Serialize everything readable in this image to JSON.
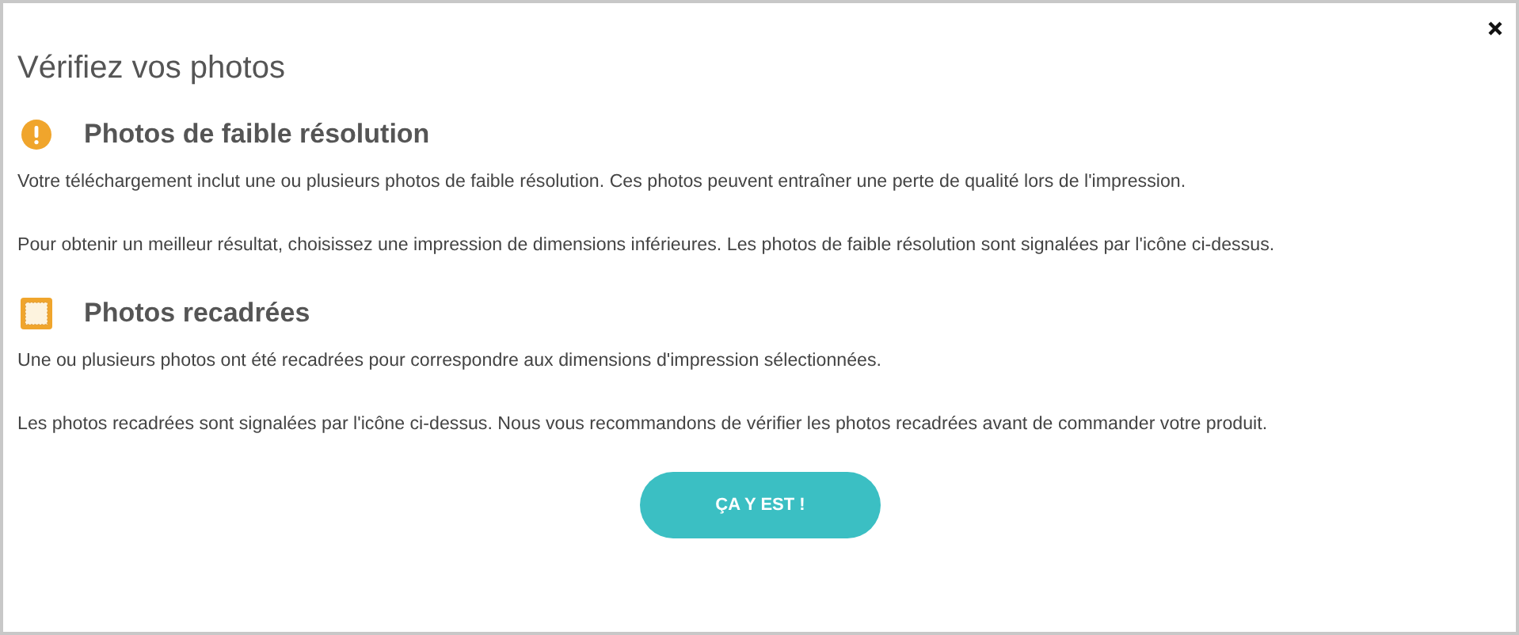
{
  "dialog": {
    "title": "Vérifiez vos photos"
  },
  "sections": [
    {
      "kind": "warning",
      "heading": "Photos de faible résolution",
      "paragraphs": [
        "Votre téléchargement inclut une ou plusieurs photos de faible résolution. Ces photos peuvent entraîner une perte de qualité lors de l'impression.",
        "Pour obtenir un meilleur résultat, choisissez une impression de dimensions inférieures. Les photos de faible résolution sont signalées par l'icône ci-dessus."
      ]
    },
    {
      "kind": "cropped",
      "heading": "Photos recadrées",
      "paragraphs": [
        "Une ou plusieurs photos ont été recadrées pour correspondre aux dimensions d'impression sélectionnées.",
        "Les photos recadrées sont signalées par l'icône ci-dessus. Nous vous recommandons de vérifier les photos recadrées avant de commander votre produit."
      ]
    }
  ],
  "button": "ÇA Y EST !"
}
